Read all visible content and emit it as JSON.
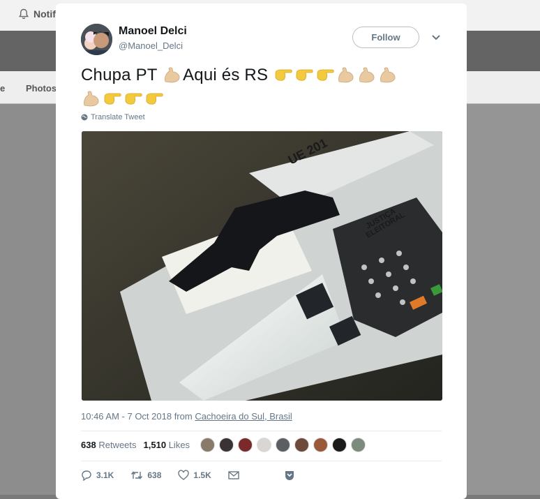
{
  "background": {
    "notifications_label": "Notifi",
    "tab_left_partial": "e",
    "tab_photos_partial": "Photos"
  },
  "tweet": {
    "author": {
      "name": "Manoel Delci",
      "handle": "@Manoel_Delci"
    },
    "follow_label": "Follow",
    "text_part1": "Chupa PT ",
    "text_part2": "Aqui és RS ",
    "emojis": [
      "flexed-biceps",
      "backhand-pointing-right",
      "backhand-pointing-right",
      "backhand-pointing-right",
      "flexed-biceps",
      "flexed-biceps",
      "flexed-biceps",
      "flexed-biceps",
      "backhand-pointing-right",
      "backhand-pointing-right",
      "backhand-pointing-right"
    ],
    "translate_label": "Translate Tweet",
    "timestamp_text": "10:46 AM - 7 Oct 2018 from ",
    "location": "Cachoeira do Sul, Brasil",
    "retweets_count": "638",
    "retweets_label": "Retweets",
    "likes_count": "1,510",
    "likes_label": "Likes",
    "actions": {
      "replies": "3.1K",
      "retweets": "638",
      "likes": "1.5K"
    },
    "media_text": {
      "ue": "UE 201",
      "justica": "JUSTIÇA",
      "eleitoral": "ELEITORAL"
    }
  },
  "colors": {
    "accent": "#1da1f2",
    "text_primary": "#14171a",
    "text_secondary": "#657786",
    "emoji_skin": "#e8c9a0"
  }
}
